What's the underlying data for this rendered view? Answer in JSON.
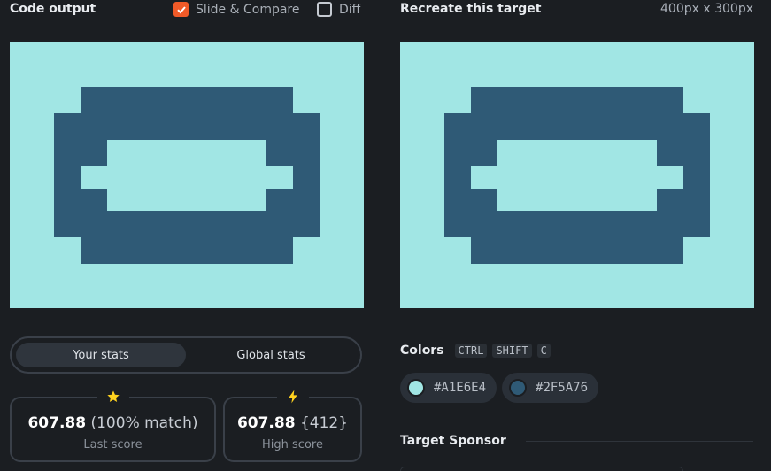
{
  "left_panel": {
    "title": "Code output",
    "slide_compare": {
      "label": "Slide & Compare",
      "checked": true
    },
    "diff": {
      "label": "Diff",
      "checked": false
    },
    "stats_tabs": [
      {
        "label": "Your stats",
        "active": true
      },
      {
        "label": "Global stats",
        "active": false
      }
    ],
    "last_score": {
      "value": "607.88",
      "detail": "(100% match)",
      "label": "Last score",
      "icon": "star-icon"
    },
    "high_score": {
      "value": "607.88",
      "detail": "{412}",
      "label": "High score",
      "icon": "lightning-icon"
    }
  },
  "right_panel": {
    "title": "Recreate this target",
    "size": "400px x 300px",
    "colors_title": "Colors",
    "shortcut_keys": [
      "CTRL",
      "SHIFT",
      "C"
    ],
    "colors": [
      {
        "hex": "#A1E6E4",
        "value": "#a1e6e4"
      },
      {
        "hex": "#2F5A76",
        "value": "#2f5a76"
      }
    ],
    "sponsor_title": "Target Sponsor"
  },
  "theme": {
    "accent": "#f05a28",
    "background": "#1b1e22",
    "star": "#ffd21f"
  }
}
